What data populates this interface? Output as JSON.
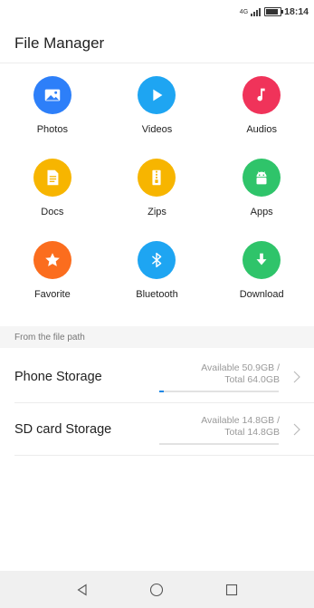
{
  "status_bar": {
    "network": "4G",
    "time": "18:14"
  },
  "header": {
    "title": "File Manager"
  },
  "categories": [
    {
      "label": "Photos",
      "icon": "image-icon",
      "color": "#2d7ff9"
    },
    {
      "label": "Videos",
      "icon": "play-icon",
      "color": "#1ea5f2"
    },
    {
      "label": "Audios",
      "icon": "music-note-icon",
      "color": "#f0335a"
    },
    {
      "label": "Docs",
      "icon": "document-icon",
      "color": "#f7b500"
    },
    {
      "label": "Zips",
      "icon": "zip-icon",
      "color": "#f7b500"
    },
    {
      "label": "Apps",
      "icon": "android-icon",
      "color": "#2fc46a"
    },
    {
      "label": "Favorite",
      "icon": "star-icon",
      "color": "#fb6d1e"
    },
    {
      "label": "Bluetooth",
      "icon": "bluetooth-icon",
      "color": "#1ea5f2"
    },
    {
      "label": "Download",
      "icon": "download-arrow-icon",
      "color": "#2fc46a"
    }
  ],
  "section": {
    "label": "From the file path"
  },
  "storage": [
    {
      "name": "Phone Storage",
      "available_line": "Available 50.9GB /",
      "total_line": "Total 64.0GB",
      "used_fraction": 0.04
    },
    {
      "name": "SD card Storage",
      "available_line": "Available 14.8GB /",
      "total_line": "Total 14.8GB",
      "used_fraction": 0.0
    }
  ],
  "nav": {
    "back": "back-icon",
    "home": "home-icon",
    "recents": "recents-icon"
  }
}
